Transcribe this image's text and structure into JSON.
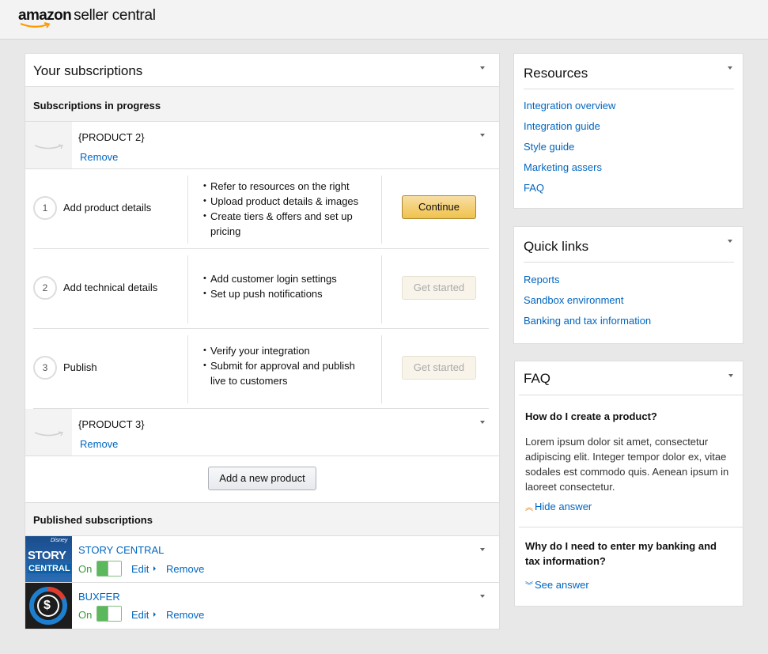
{
  "header": {
    "logo_word": "amazon",
    "logo_suffix": "seller central"
  },
  "subscriptions": {
    "title": "Your subscriptions",
    "in_progress_label": "Subscriptions in progress",
    "product_2": {
      "name": "{PRODUCT 2}",
      "remove": "Remove"
    },
    "steps": [
      {
        "number": "1",
        "label": "Add product details",
        "bullets": [
          "Refer to resources on the right",
          "Upload product details & images",
          "Create tiers & offers and set up pricing"
        ],
        "button": "Continue"
      },
      {
        "number": "2",
        "label": "Add technical details",
        "bullets": [
          "Add customer login settings",
          "Set up push notifications"
        ],
        "button": "Get started"
      },
      {
        "number": "3",
        "label": "Publish",
        "bullets": [
          "Verify your integration",
          "Submit for approval and publish live to customers"
        ],
        "button": "Get started"
      }
    ],
    "product_3": {
      "name": "{PRODUCT 3}",
      "remove": "Remove"
    },
    "add_new": "Add a new product",
    "published_label": "Published subscriptions",
    "published": [
      {
        "name": "STORY CENTRAL",
        "status": "On",
        "edit": "Edit",
        "remove": "Remove",
        "logo_top": "Disney",
        "logo_line1": "STORY",
        "logo_line2": "CENTRAL"
      },
      {
        "name": "BUXFER",
        "status": "On",
        "edit": "Edit",
        "remove": "Remove",
        "logo_symbol": "$"
      }
    ]
  },
  "resources": {
    "title": "Resources",
    "links": [
      "Integration overview",
      "Integration guide",
      "Style guide",
      "Marketing assers",
      "FAQ"
    ]
  },
  "quick_links": {
    "title": "Quick links",
    "links": [
      "Reports",
      "Sandbox environment",
      "Banking and tax information"
    ]
  },
  "faq": {
    "title": "FAQ",
    "items": [
      {
        "question": "How do I create a product?",
        "answer": "Lorem ipsum dolor sit amet, consectetur adipiscing elit. Integer tempor dolor ex, vitae sodales est commodo quis. Aenean ipsum in laoreet consectetur.",
        "toggle": "Hide answer"
      },
      {
        "question": "Why do I need to enter my banking and tax information?",
        "toggle": "See answer"
      }
    ]
  },
  "colors": {
    "link": "#0066c0",
    "primary_button": "#f0c14b",
    "toggle_on": "#5cb85c",
    "amazon_orange": "#ff9900"
  }
}
